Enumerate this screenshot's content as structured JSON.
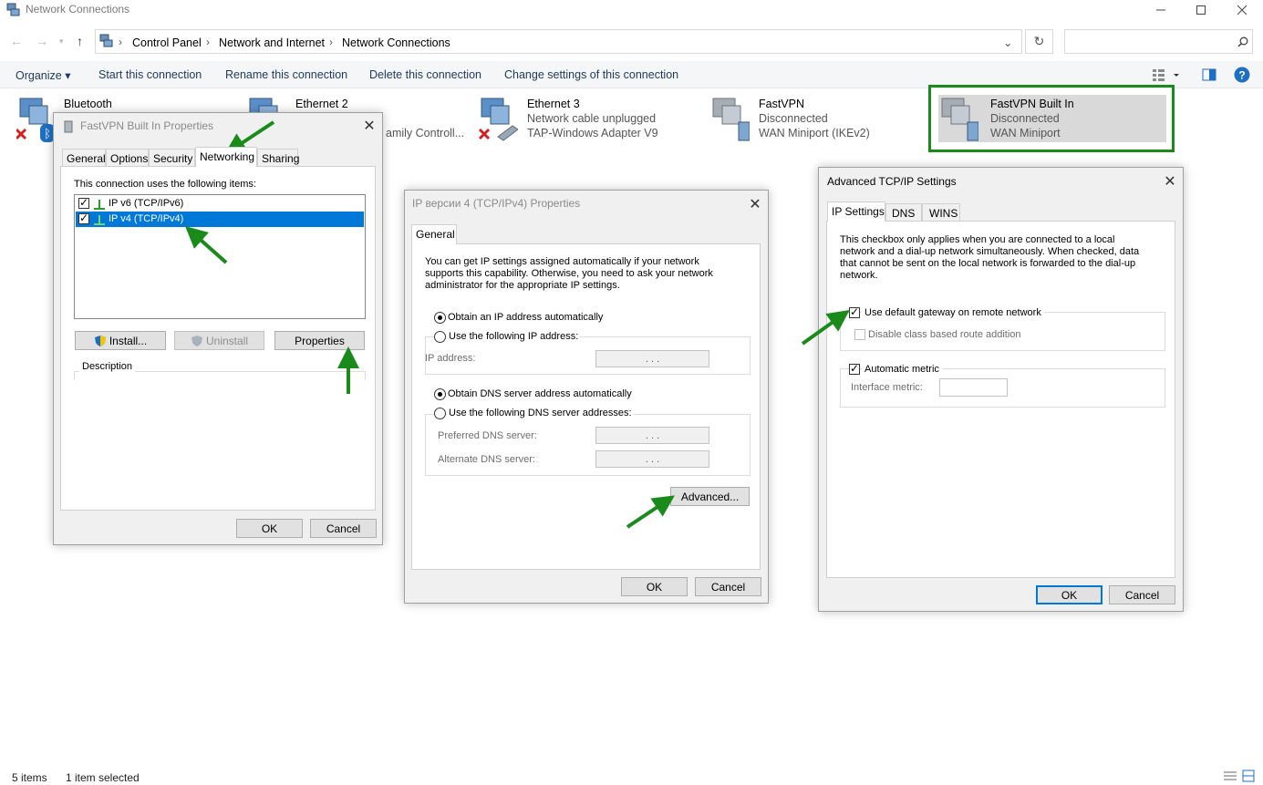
{
  "window": {
    "title": "Network Connections"
  },
  "address": {
    "crumbs": [
      "Control Panel",
      "Network and Internet",
      "Network Connections"
    ]
  },
  "toolbar": {
    "organize": "Organize ▾",
    "start": "Start this connection",
    "rename": "Rename this connection",
    "delete": "Delete this connection",
    "change": "Change settings of this connection"
  },
  "connections": [
    {
      "name": "Bluetooth",
      "status": "",
      "device": ""
    },
    {
      "name": "Ethernet 2",
      "status": "",
      "device": "amily Controll..."
    },
    {
      "name": "Ethernet 3",
      "status": "Network cable unplugged",
      "device": "TAP-Windows Adapter V9"
    },
    {
      "name": "FastVPN",
      "status": "Disconnected",
      "device": "WAN Miniport (IKEv2)"
    },
    {
      "name": "FastVPN Built In",
      "status": "Disconnected",
      "device": "WAN Miniport"
    }
  ],
  "status": {
    "count": "5 items",
    "selected": "1 item selected"
  },
  "props_dialog": {
    "title": "FastVPN Built In Properties",
    "tabs": [
      "General",
      "Options",
      "Security",
      "Networking",
      "Sharing"
    ],
    "uses_label": "This connection uses the following items:",
    "items": [
      {
        "label": "IP v6 (TCP/IPv6)",
        "checked": true
      },
      {
        "label": "IP v4 (TCP/IPv4)",
        "checked": true
      }
    ],
    "install": "Install...",
    "uninstall": "Uninstall",
    "properties": "Properties",
    "description": "Description",
    "ok": "OK",
    "cancel": "Cancel"
  },
  "ipv4_dialog": {
    "title": "IP версии 4 (TCP/IPv4) Properties",
    "tab": "General",
    "intro": [
      "You can get IP settings assigned automatically if your network",
      "supports this capability. Otherwise, you need to ask your network",
      "administrator for the appropriate IP settings."
    ],
    "obtain_ip": "Obtain an IP address automatically",
    "use_ip": "Use the following IP address:",
    "ip_address": "IP address:",
    "obtain_dns": "Obtain DNS server address automatically",
    "use_dns": "Use the following DNS server addresses:",
    "preferred_dns": "Preferred DNS server:",
    "alternate_dns": "Alternate DNS server:",
    "ip_dots": ". . .",
    "advanced": "Advanced...",
    "ok": "OK",
    "cancel": "Cancel"
  },
  "adv_dialog": {
    "title": "Advanced TCP/IP Settings",
    "tabs": [
      "IP Settings",
      "DNS",
      "WINS"
    ],
    "info": [
      "This checkbox only applies when you are connected to a local",
      "network and a dial-up network simultaneously.  When checked, data",
      "that cannot be sent on the local network is forwarded to the dial-up",
      "network."
    ],
    "use_gateway": "Use default gateway on remote network",
    "disable_class": "Disable class based route addition",
    "auto_metric": "Automatic metric",
    "interface_metric": "Interface metric:",
    "ok": "OK",
    "cancel": "Cancel"
  },
  "colors": {
    "annotation_arrow": "#1a8a1a",
    "selection_blue": "#0078d7"
  }
}
